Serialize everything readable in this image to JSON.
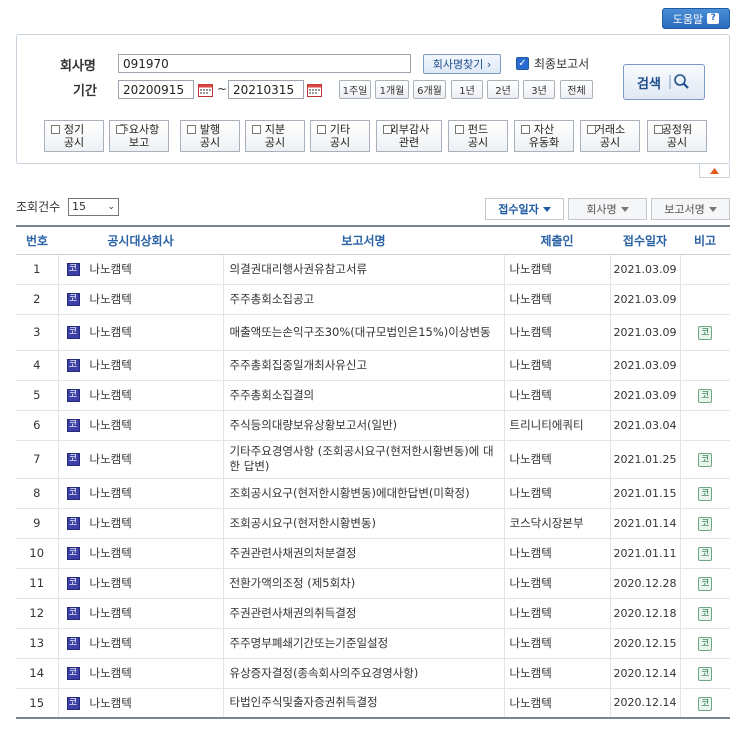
{
  "help": {
    "label": "도움말",
    "icon": "question-icon"
  },
  "search": {
    "company_label": "회사명",
    "company_value": "091970",
    "find_company_button": "회사명찾기 ›",
    "final_report_label": "최종보고서",
    "final_report_checked": true,
    "period_label": "기간",
    "start_date": "20200915",
    "end_date": "20210315",
    "date_separator": "~",
    "period_buttons": [
      "1주일",
      "1개월",
      "6개월",
      "1년",
      "2년",
      "3년",
      "전체"
    ],
    "search_button": "검색",
    "categories": [
      "정기\n공시",
      "주요사항\n보고",
      "발행\n공시",
      "지분\n공시",
      "기타\n공시",
      "외부감사\n관련",
      "펀드\n공시",
      "자산\n유동화",
      "거래소\n공시",
      "공정위\n공시"
    ]
  },
  "results": {
    "count_label": "조회건수",
    "count_value": "15",
    "sort_buttons": [
      "접수일자",
      "회사명",
      "보고서명"
    ],
    "columns": [
      "번호",
      "공시대상회사",
      "보고서명",
      "제출인",
      "접수일자",
      "비고"
    ],
    "corp_badge": "코",
    "remark_badge": "코",
    "rows": [
      {
        "no": "1",
        "corp": "나노캠텍",
        "report": "의결권대리행사권유참고서류",
        "submitter": "나노캠텍",
        "date": "2021.03.09",
        "remark": false
      },
      {
        "no": "2",
        "corp": "나노캠텍",
        "report": "주주총회소집공고",
        "submitter": "나노캠텍",
        "date": "2021.03.09",
        "remark": false
      },
      {
        "no": "3",
        "corp": "나노캠텍",
        "report": "매출액또는손익구조30%(대규모법인은15%)이상변동",
        "submitter": "나노캠텍",
        "date": "2021.03.09",
        "remark": true
      },
      {
        "no": "4",
        "corp": "나노캠텍",
        "report": "주주총회집중일개최사유신고",
        "submitter": "나노캠텍",
        "date": "2021.03.09",
        "remark": false
      },
      {
        "no": "5",
        "corp": "나노캠텍",
        "report": "주주총회소집결의",
        "submitter": "나노캠텍",
        "date": "2021.03.09",
        "remark": true
      },
      {
        "no": "6",
        "corp": "나노캠텍",
        "report": "주식등의대량보유상황보고서(일반)",
        "submitter": "트리니티에쿼티",
        "date": "2021.03.04",
        "remark": false
      },
      {
        "no": "7",
        "corp": "나노캠텍",
        "report": "기타주요경영사항 (조회공시요구(현저한시황변동)에 대한 답변)",
        "submitter": "나노캠텍",
        "date": "2021.01.25",
        "remark": true
      },
      {
        "no": "8",
        "corp": "나노캠텍",
        "report": "조회공시요구(현저한시황변동)에대한답변(미확정)",
        "submitter": "나노캠텍",
        "date": "2021.01.15",
        "remark": true
      },
      {
        "no": "9",
        "corp": "나노캠텍",
        "report": "조회공시요구(현저한시황변동)",
        "submitter": "코스닥시장본부",
        "date": "2021.01.14",
        "remark": true
      },
      {
        "no": "10",
        "corp": "나노캠텍",
        "report": "주권관련사채권의처분결정",
        "submitter": "나노캠텍",
        "date": "2021.01.11",
        "remark": true
      },
      {
        "no": "11",
        "corp": "나노캠텍",
        "report": "전환가액의조정 (제5회차)",
        "submitter": "나노캠텍",
        "date": "2020.12.28",
        "remark": true
      },
      {
        "no": "12",
        "corp": "나노캠텍",
        "report": "주권관련사채권의취득결정",
        "submitter": "나노캠텍",
        "date": "2020.12.18",
        "remark": true
      },
      {
        "no": "13",
        "corp": "나노캠텍",
        "report": "주주명부폐쇄기간또는기준일설정",
        "submitter": "나노캠텍",
        "date": "2020.12.15",
        "remark": true
      },
      {
        "no": "14",
        "corp": "나노캠텍",
        "report": "유상증자결정(종속회사의주요경영사항)",
        "submitter": "나노캠텍",
        "date": "2020.12.14",
        "remark": true
      },
      {
        "no": "15",
        "corp": "나노캠텍",
        "report": "타법인주식및출자증권취득결정",
        "submitter": "나노캠텍",
        "date": "2020.12.14",
        "remark": true
      }
    ]
  }
}
